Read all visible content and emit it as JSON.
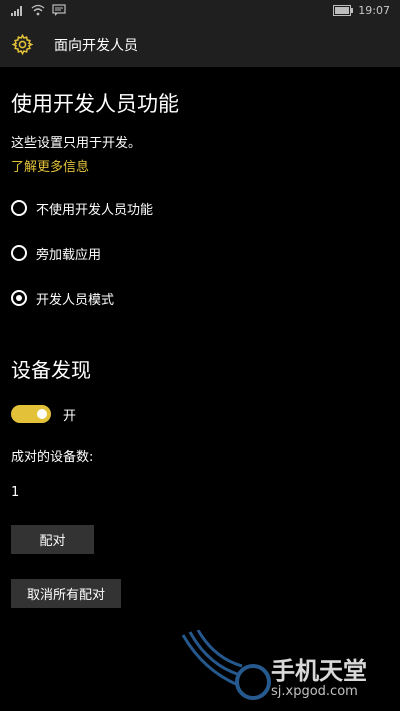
{
  "status_bar": {
    "time": "19:07",
    "icons": [
      "signal-icon",
      "wifi-icon",
      "message-icon",
      "battery-icon"
    ]
  },
  "header": {
    "title": "面向开发人员",
    "icon": "gear-icon"
  },
  "developer_features": {
    "heading": "使用开发人员功能",
    "description": "这些设置只用于开发。",
    "learn_more": "了解更多信息",
    "options": [
      {
        "label": "不使用开发人员功能",
        "checked": false
      },
      {
        "label": "旁加载应用",
        "checked": false
      },
      {
        "label": "开发人员模式",
        "checked": true
      }
    ]
  },
  "device_discovery": {
    "heading": "设备发现",
    "toggle_label": "开",
    "toggle_on": true,
    "paired_label": "成对的设备数:",
    "paired_count": "1",
    "pair_button": "配对",
    "unpair_all_button": "取消所有配对"
  },
  "watermark": {
    "text": "手机天堂",
    "url": "sj.xpgod.com"
  },
  "colors": {
    "accent": "#e3c23a",
    "background": "#000000",
    "header": "#1f1f1f",
    "button": "#333333"
  }
}
